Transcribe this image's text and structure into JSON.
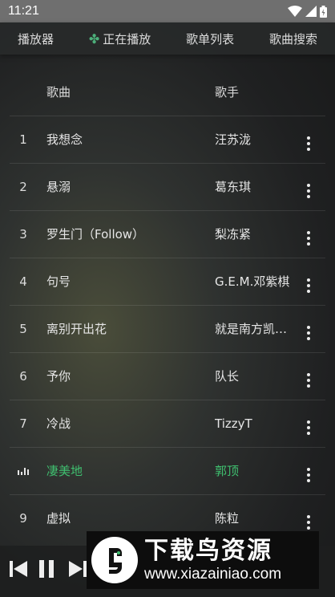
{
  "status_bar": {
    "time": "11:21"
  },
  "nav": {
    "tabs": [
      {
        "label": "播放器",
        "active": false
      },
      {
        "label": "正在播放",
        "active": true
      },
      {
        "label": "歌单列表",
        "active": false
      },
      {
        "label": "歌曲搜索",
        "active": false
      }
    ]
  },
  "list": {
    "header": {
      "title": "歌曲",
      "artist": "歌手"
    },
    "songs": [
      {
        "index": "1",
        "title": "我想念",
        "artist": "汪苏泷"
      },
      {
        "index": "2",
        "title": "悬溺",
        "artist": "葛东琪"
      },
      {
        "index": "3",
        "title": "罗生门（Follow）",
        "artist": "梨冻紧"
      },
      {
        "index": "4",
        "title": "句号",
        "artist": "G.E.M.邓紫棋"
      },
      {
        "index": "5",
        "title": "离别开出花",
        "artist": "就是南方凯…"
      },
      {
        "index": "6",
        "title": "予你",
        "artist": "队长"
      },
      {
        "index": "7",
        "title": "冷战",
        "artist": "TizzyT"
      },
      {
        "index": "",
        "title": "凄美地",
        "artist": "郭顶",
        "playing": true
      },
      {
        "index": "9",
        "title": "虚拟",
        "artist": "陈粒"
      }
    ]
  },
  "colors": {
    "accent": "#3fbf6f",
    "status_bar": "#6f6f6f"
  },
  "watermark": {
    "title": "下载鸟资源",
    "url": "www.xiazainiao.com"
  }
}
